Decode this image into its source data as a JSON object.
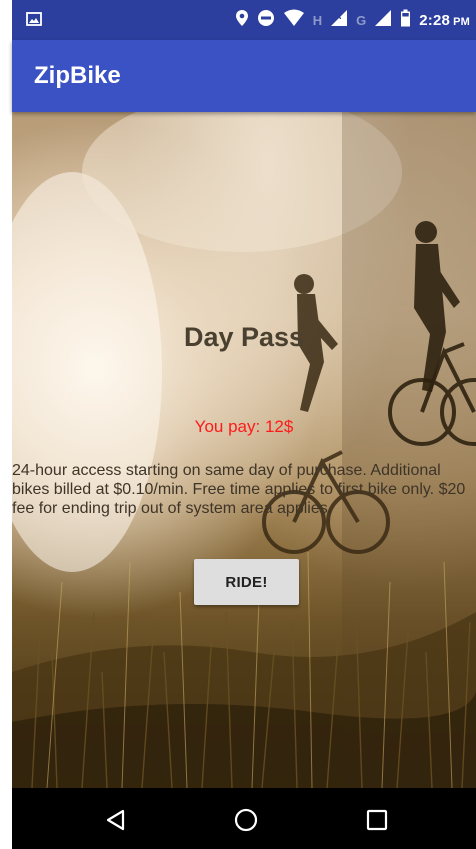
{
  "status_bar": {
    "time": "2:28",
    "ampm": "PM",
    "network_h": "H",
    "network_g": "G",
    "icons": [
      "image-icon",
      "location-icon",
      "do-not-disturb-icon",
      "wifi-icon",
      "signal-roaming-icon",
      "signal-icon",
      "battery-icon"
    ]
  },
  "app_bar": {
    "title": "ZipBike"
  },
  "pass": {
    "title": "Day Pass",
    "price": "You pay: 12$",
    "description": "24-hour access starting on same day of purchase. Additional bikes billed at $0.10/min. Free time applies to first bike only. $20 fee for ending trip out of system area applies.",
    "button_label": "RIDE!"
  },
  "nav_bar": {
    "icons": [
      "back-icon",
      "home-icon",
      "recents-icon"
    ]
  },
  "colors": {
    "status_bar": "#2c3f9e",
    "app_bar": "#3b52c4",
    "price_text": "#ff1a1a",
    "button_bg": "#dedede"
  }
}
